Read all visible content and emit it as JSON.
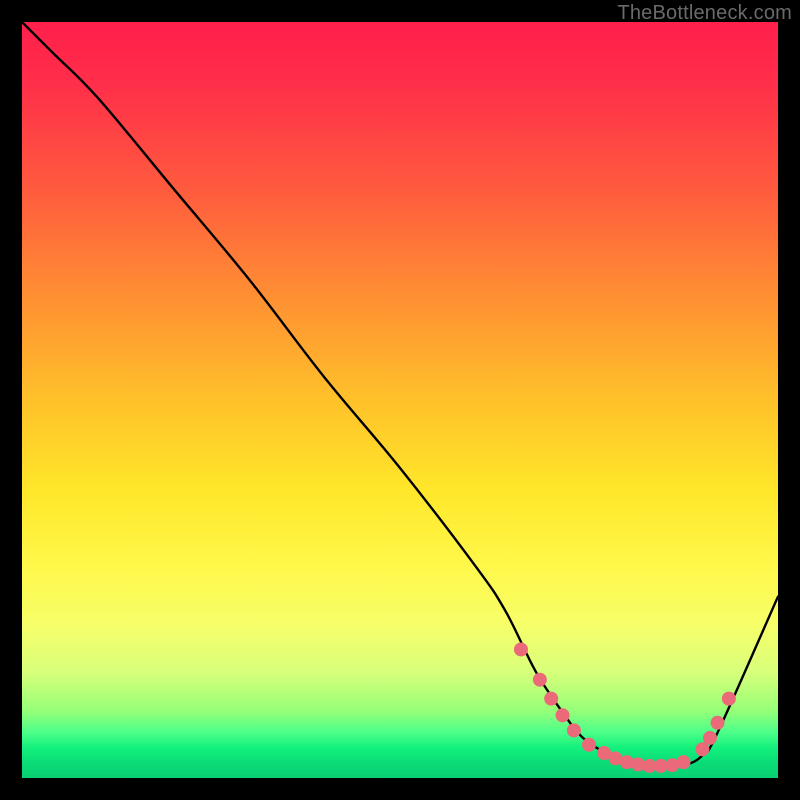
{
  "watermark": "TheBottleneck.com",
  "chart_data": {
    "type": "line",
    "title": "",
    "xlabel": "",
    "ylabel": "",
    "xlim": [
      0,
      100
    ],
    "ylim": [
      0,
      100
    ],
    "grid": false,
    "series": [
      {
        "name": "curve",
        "x": [
          0,
          4,
          10,
          20,
          30,
          40,
          50,
          60,
          64,
          68,
          72,
          74,
          76,
          78,
          80,
          82,
          84,
          86,
          88,
          90,
          92,
          100
        ],
        "y": [
          100,
          96,
          90,
          78,
          66,
          53,
          41,
          28,
          22,
          14,
          8,
          5.5,
          4,
          3,
          2.2,
          1.8,
          1.6,
          1.6,
          1.8,
          3,
          6,
          24
        ]
      }
    ],
    "markers": [
      {
        "x": 66,
        "y": 17
      },
      {
        "x": 68.5,
        "y": 13
      },
      {
        "x": 70,
        "y": 10.5
      },
      {
        "x": 71.5,
        "y": 8.3
      },
      {
        "x": 73,
        "y": 6.3
      },
      {
        "x": 75,
        "y": 4.4
      },
      {
        "x": 77,
        "y": 3.3
      },
      {
        "x": 78.5,
        "y": 2.6
      },
      {
        "x": 80,
        "y": 2.1
      },
      {
        "x": 81.5,
        "y": 1.8
      },
      {
        "x": 83,
        "y": 1.6
      },
      {
        "x": 84.5,
        "y": 1.6
      },
      {
        "x": 86,
        "y": 1.7
      },
      {
        "x": 87.5,
        "y": 2.1
      },
      {
        "x": 90,
        "y": 3.8
      },
      {
        "x": 91,
        "y": 5.3
      },
      {
        "x": 92,
        "y": 7.3
      },
      {
        "x": 93.5,
        "y": 10.5
      }
    ],
    "colors": {
      "line": "#000000",
      "marker_fill": "#ea6a7a",
      "marker_stroke": "#c94a5a",
      "gradient_top": "#ff1f4b",
      "gradient_bottom": "#08cf73"
    }
  }
}
